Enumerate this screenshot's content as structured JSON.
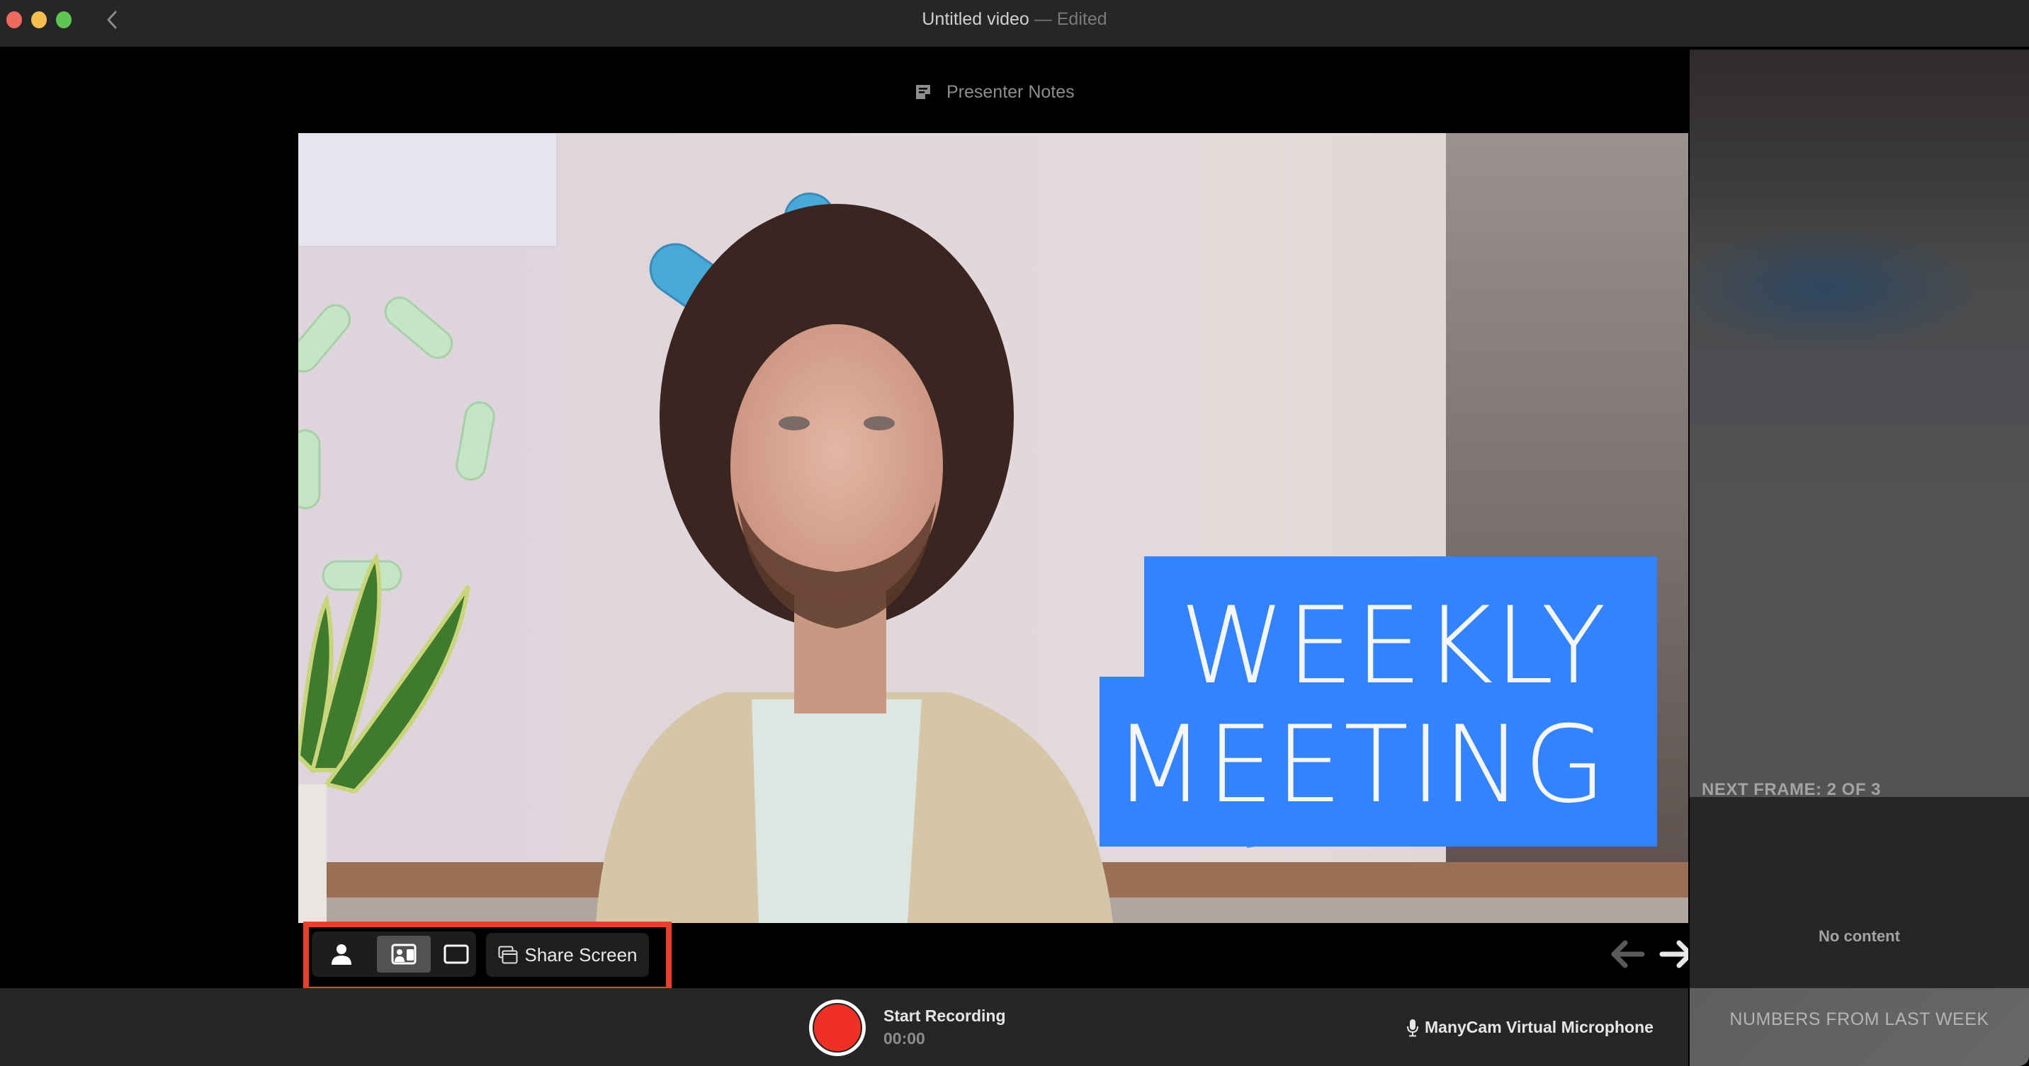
{
  "window": {
    "title": "Untitled video",
    "title_separator": " — ",
    "title_status": "Edited",
    "controls": [
      "close",
      "minimize",
      "maximize"
    ],
    "back_icon": "chevron-left-icon"
  },
  "stage": {
    "presenter_notes_label": "Presenter Notes",
    "presenter_notes_icon": "notes-icon",
    "video": {
      "overlay_line1": "WEEKLY",
      "overlay_line2": "MEETING",
      "overlay_color": "#3383ff"
    },
    "layout_modes": [
      {
        "name": "camera-only",
        "icon": "person-icon",
        "selected": false
      },
      {
        "name": "camera-and-screen",
        "icon": "camera-screen-icon",
        "selected": true
      },
      {
        "name": "screen-only",
        "icon": "screen-icon",
        "selected": false
      }
    ],
    "share_screen_label": "Share Screen",
    "share_screen_icon": "windows-icon",
    "highlight_color": "#e8402a",
    "nav": {
      "prev_icon": "arrow-left-icon",
      "next_icon": "arrow-right-icon"
    }
  },
  "bottombar": {
    "record_label": "Start Recording",
    "record_time": "00:00",
    "record_color": "#ee3124",
    "microphone_label": "ManyCam Virtual Microphone",
    "microphone_icon": "microphone-icon"
  },
  "right_panel": {
    "next_frame_label": "NEXT FRAME: 2 OF 3",
    "no_content_label": "No content",
    "next_card_label": "NUMBERS FROM LAST WEEK"
  }
}
